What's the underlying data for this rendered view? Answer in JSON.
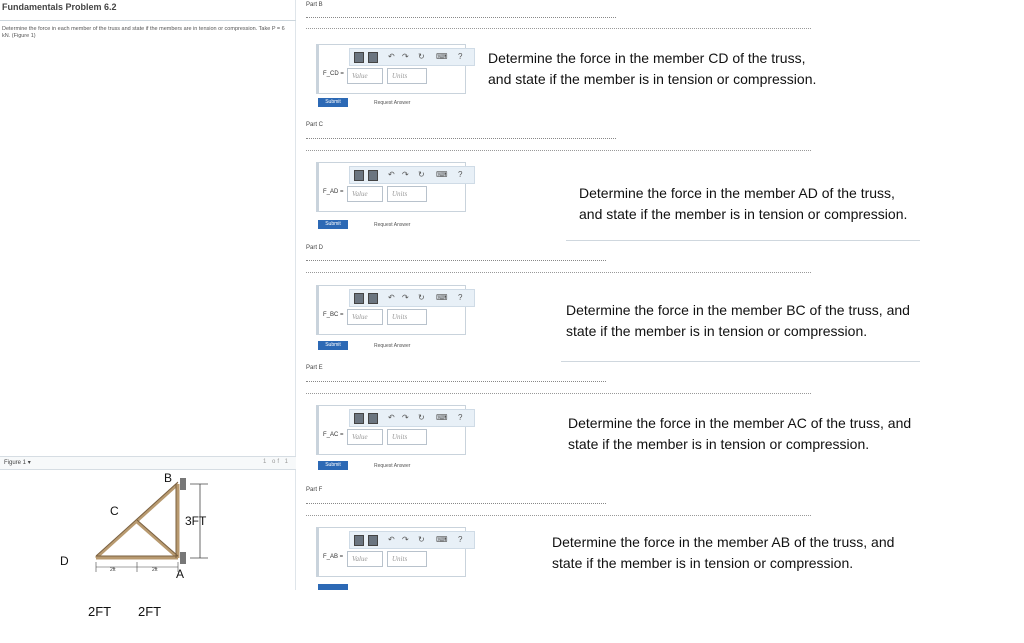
{
  "left": {
    "title": "Fundamentals Problem 6.2",
    "problem_text": "Determine the force in each member of the truss and state if the members are in tension or compression. Take P = 6 kN. (Figure 1)",
    "figure_select": "Figure 1",
    "figure_pager": "1 of 1"
  },
  "truss": {
    "labels": {
      "B": "B",
      "C": "C",
      "D": "D",
      "A": "A",
      "height": "3FT",
      "bottom_small": "2ft",
      "bottom_small2": "2ft"
    }
  },
  "dims": {
    "left": "2FT",
    "right": "2FT"
  },
  "parts": [
    {
      "label": "Part B",
      "line1": "Determine the force in the member CD of the truss, and state if the member is in tension or compression.",
      "line2": "Express your answer to three significant figures and include the appropriate units. Assume positive scalars for members in tension and negative scalars for members in compression.",
      "fx": "F_CD =",
      "value_placeholder": "Value",
      "units_placeholder": "Units",
      "submit": "Submit",
      "request": "Request Answer",
      "question": [
        "Determine the force in the member CD of the truss,",
        "and state if the member is in tension or compression."
      ]
    },
    {
      "label": "Part C",
      "line1": "Determine the force in the member AD of the truss, and state if the member is in tension or compression.",
      "line2": "Express your answer to three significant figures and include the appropriate units. Assume positive scalars for members in tension and negative scalars for members in compression.",
      "fx": "F_AD =",
      "value_placeholder": "Value",
      "units_placeholder": "Units",
      "submit": "Submit",
      "request": "Request Answer",
      "question": [
        "Determine the force in the member AD of the truss,",
        "and state if the member is in tension or compression."
      ]
    },
    {
      "label": "Part D",
      "line1": "Determine the force in the member BC of the truss, and state if the member is in tension or compression.",
      "line2": "Express your answer to three significant figures and include the appropriate units. Assume positive scalars for members in tension and negative scalars for members in compression.",
      "fx": "F_BC =",
      "value_placeholder": "Value",
      "units_placeholder": "Units",
      "submit": "Submit",
      "request": "Request Answer",
      "question": [
        "Determine the force in the member BC of the truss, and",
        "state if the member is in tension or compression."
      ]
    },
    {
      "label": "Part E",
      "line1": "Determine the force in the member AC of the truss, and state if the member is in tension or compression.",
      "line2": "Express your answer to three significant figures and include the appropriate units. Assume positive scalars for members in tension and negative scalars for members in compression.",
      "fx": "F_AC =",
      "value_placeholder": "Value",
      "units_placeholder": "Units",
      "submit": "Submit",
      "request": "Request Answer",
      "question": [
        "Determine the force in the member AC of the truss, and",
        "state if the member is in tension or compression."
      ]
    },
    {
      "label": "Part F",
      "line1": "Determine the force in the member AB of the truss, and state if the member is in tension or compression.",
      "line2": "Express your answer to three significant figures and include the appropriate units. Assume positive scalars for members in tension and negative scalars for members in compression.",
      "fx": "F_AB =",
      "value_placeholder": "Value",
      "units_placeholder": "Units",
      "submit": "Submit",
      "request": "Request Answer",
      "question": [
        "Determine the force in the member AB of the truss, and",
        "state if the member is in tension or compression."
      ]
    }
  ],
  "colors": {
    "submit": "#2c69b5",
    "toolbar_bg": "#e8f0f7",
    "separator": "#cfd7de"
  },
  "icons": [
    "templates-icon",
    "vector-icon",
    "undo-icon",
    "redo-icon",
    "reset-icon",
    "keyboard-icon",
    "help-icon"
  ]
}
